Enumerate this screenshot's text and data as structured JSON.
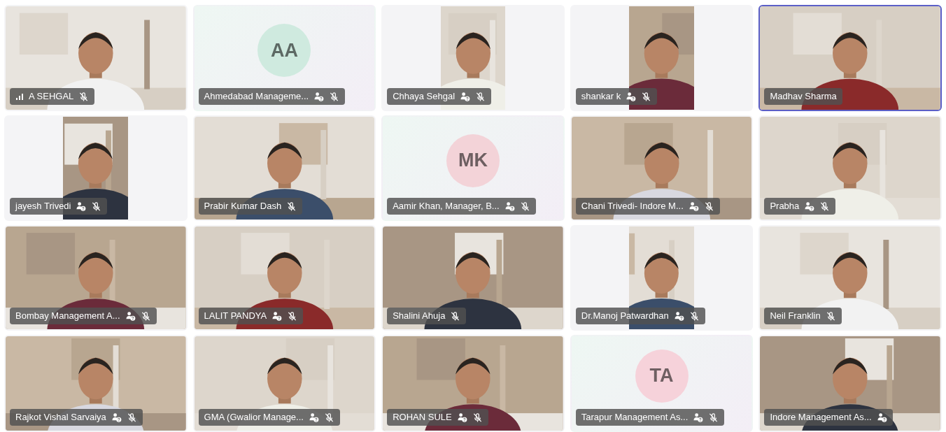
{
  "tiles": [
    {
      "name": "A SEHGAL",
      "kind": "video",
      "guest": false,
      "muted": true,
      "network_warning": true,
      "selected": false
    },
    {
      "name": "Ahmedabad Manageme...",
      "kind": "avatar",
      "initials": "AA",
      "color": "#cfeadf",
      "guest": true,
      "muted": true,
      "network_warning": false,
      "selected": false
    },
    {
      "name": "Chhaya Sehgal",
      "kind": "portrait-video",
      "guest": true,
      "muted": true,
      "network_warning": false,
      "selected": false
    },
    {
      "name": "shankar k",
      "kind": "portrait-video",
      "guest": true,
      "muted": true,
      "network_warning": false,
      "selected": false
    },
    {
      "name": "Madhav Sharma",
      "kind": "video",
      "guest": false,
      "muted": false,
      "network_warning": false,
      "selected": true
    },
    {
      "name": "jayesh Trivedi",
      "kind": "portrait-video",
      "guest": true,
      "muted": true,
      "network_warning": false,
      "selected": false
    },
    {
      "name": "Prabir Kumar Dash",
      "kind": "video",
      "guest": false,
      "muted": true,
      "network_warning": false,
      "selected": false
    },
    {
      "name": "Aamir Khan, Manager, B...",
      "kind": "avatar",
      "initials": "MK",
      "color": "#f3d3d8",
      "guest": true,
      "muted": true,
      "network_warning": false,
      "selected": false
    },
    {
      "name": "Chani Trivedi- Indore M...",
      "kind": "video",
      "guest": true,
      "muted": true,
      "network_warning": false,
      "selected": false
    },
    {
      "name": "Prabha",
      "kind": "video",
      "guest": true,
      "muted": true,
      "network_warning": false,
      "selected": false
    },
    {
      "name": "Bombay Management A...",
      "kind": "video",
      "guest": true,
      "muted": true,
      "network_warning": false,
      "selected": false
    },
    {
      "name": "LALIT PANDYA",
      "kind": "video",
      "guest": true,
      "muted": true,
      "network_warning": false,
      "selected": false
    },
    {
      "name": "Shalini Ahuja",
      "kind": "video",
      "guest": false,
      "muted": true,
      "network_warning": false,
      "selected": false
    },
    {
      "name": "Dr.Manoj Patwardhan",
      "kind": "portrait-video",
      "guest": true,
      "muted": true,
      "network_warning": false,
      "selected": false
    },
    {
      "name": "Neil Franklin",
      "kind": "video",
      "guest": false,
      "muted": true,
      "network_warning": false,
      "selected": false
    },
    {
      "name": "Rajkot Vishal Sarvaiya",
      "kind": "video",
      "guest": true,
      "muted": true,
      "network_warning": false,
      "selected": false
    },
    {
      "name": "GMA (Gwalior Manage...",
      "kind": "video",
      "guest": true,
      "muted": true,
      "network_warning": false,
      "selected": false
    },
    {
      "name": "ROHAN SULE",
      "kind": "video",
      "guest": true,
      "muted": true,
      "network_warning": false,
      "selected": false
    },
    {
      "name": "Tarapur Management As...",
      "kind": "avatar",
      "initials": "TA",
      "color": "#f6d2da",
      "guest": true,
      "muted": true,
      "network_warning": false,
      "selected": false
    },
    {
      "name": "Indore Management As...",
      "kind": "video",
      "guest": true,
      "muted": false,
      "network_warning": false,
      "selected": false
    }
  ]
}
